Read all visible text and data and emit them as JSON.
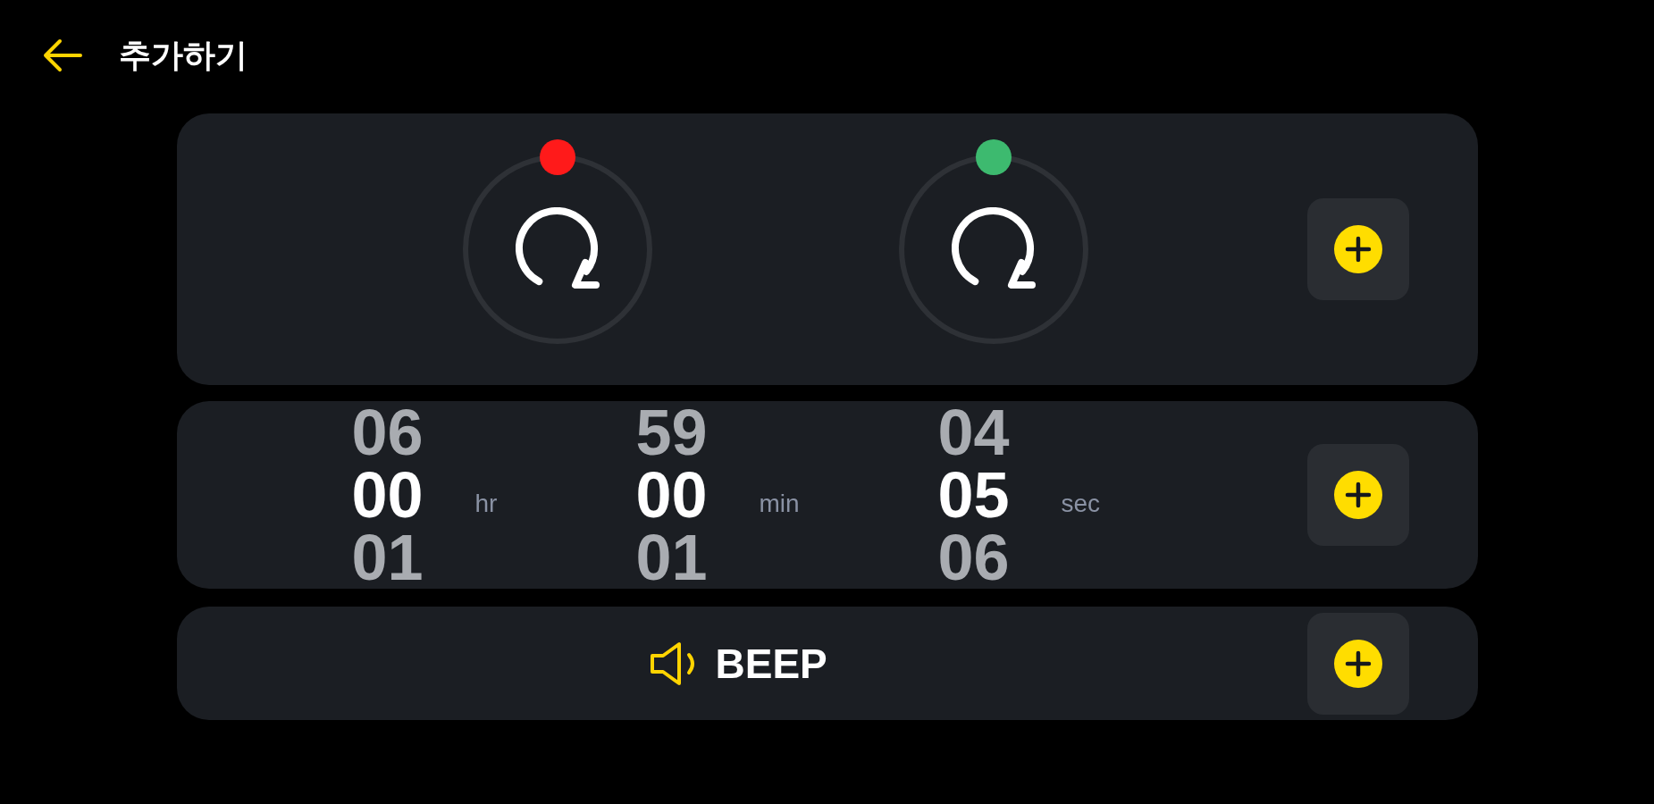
{
  "header": {
    "title": "추가하기"
  },
  "repeat_dials": [
    {
      "color": "#ff1a1a"
    },
    {
      "color": "#3dba6f"
    }
  ],
  "time_picker": {
    "columns": [
      {
        "unit": "hr",
        "values": [
          {
            "text": "06",
            "selected": false
          },
          {
            "text": "00",
            "selected": true
          },
          {
            "text": "01",
            "selected": false
          }
        ]
      },
      {
        "unit": "min",
        "values": [
          {
            "text": "59",
            "selected": false
          },
          {
            "text": "00",
            "selected": true
          },
          {
            "text": "01",
            "selected": false
          }
        ]
      },
      {
        "unit": "sec",
        "values": [
          {
            "text": "04",
            "selected": false
          },
          {
            "text": "05",
            "selected": true
          },
          {
            "text": "06",
            "selected": false
          }
        ]
      }
    ]
  },
  "sound": {
    "label": "BEEP"
  }
}
